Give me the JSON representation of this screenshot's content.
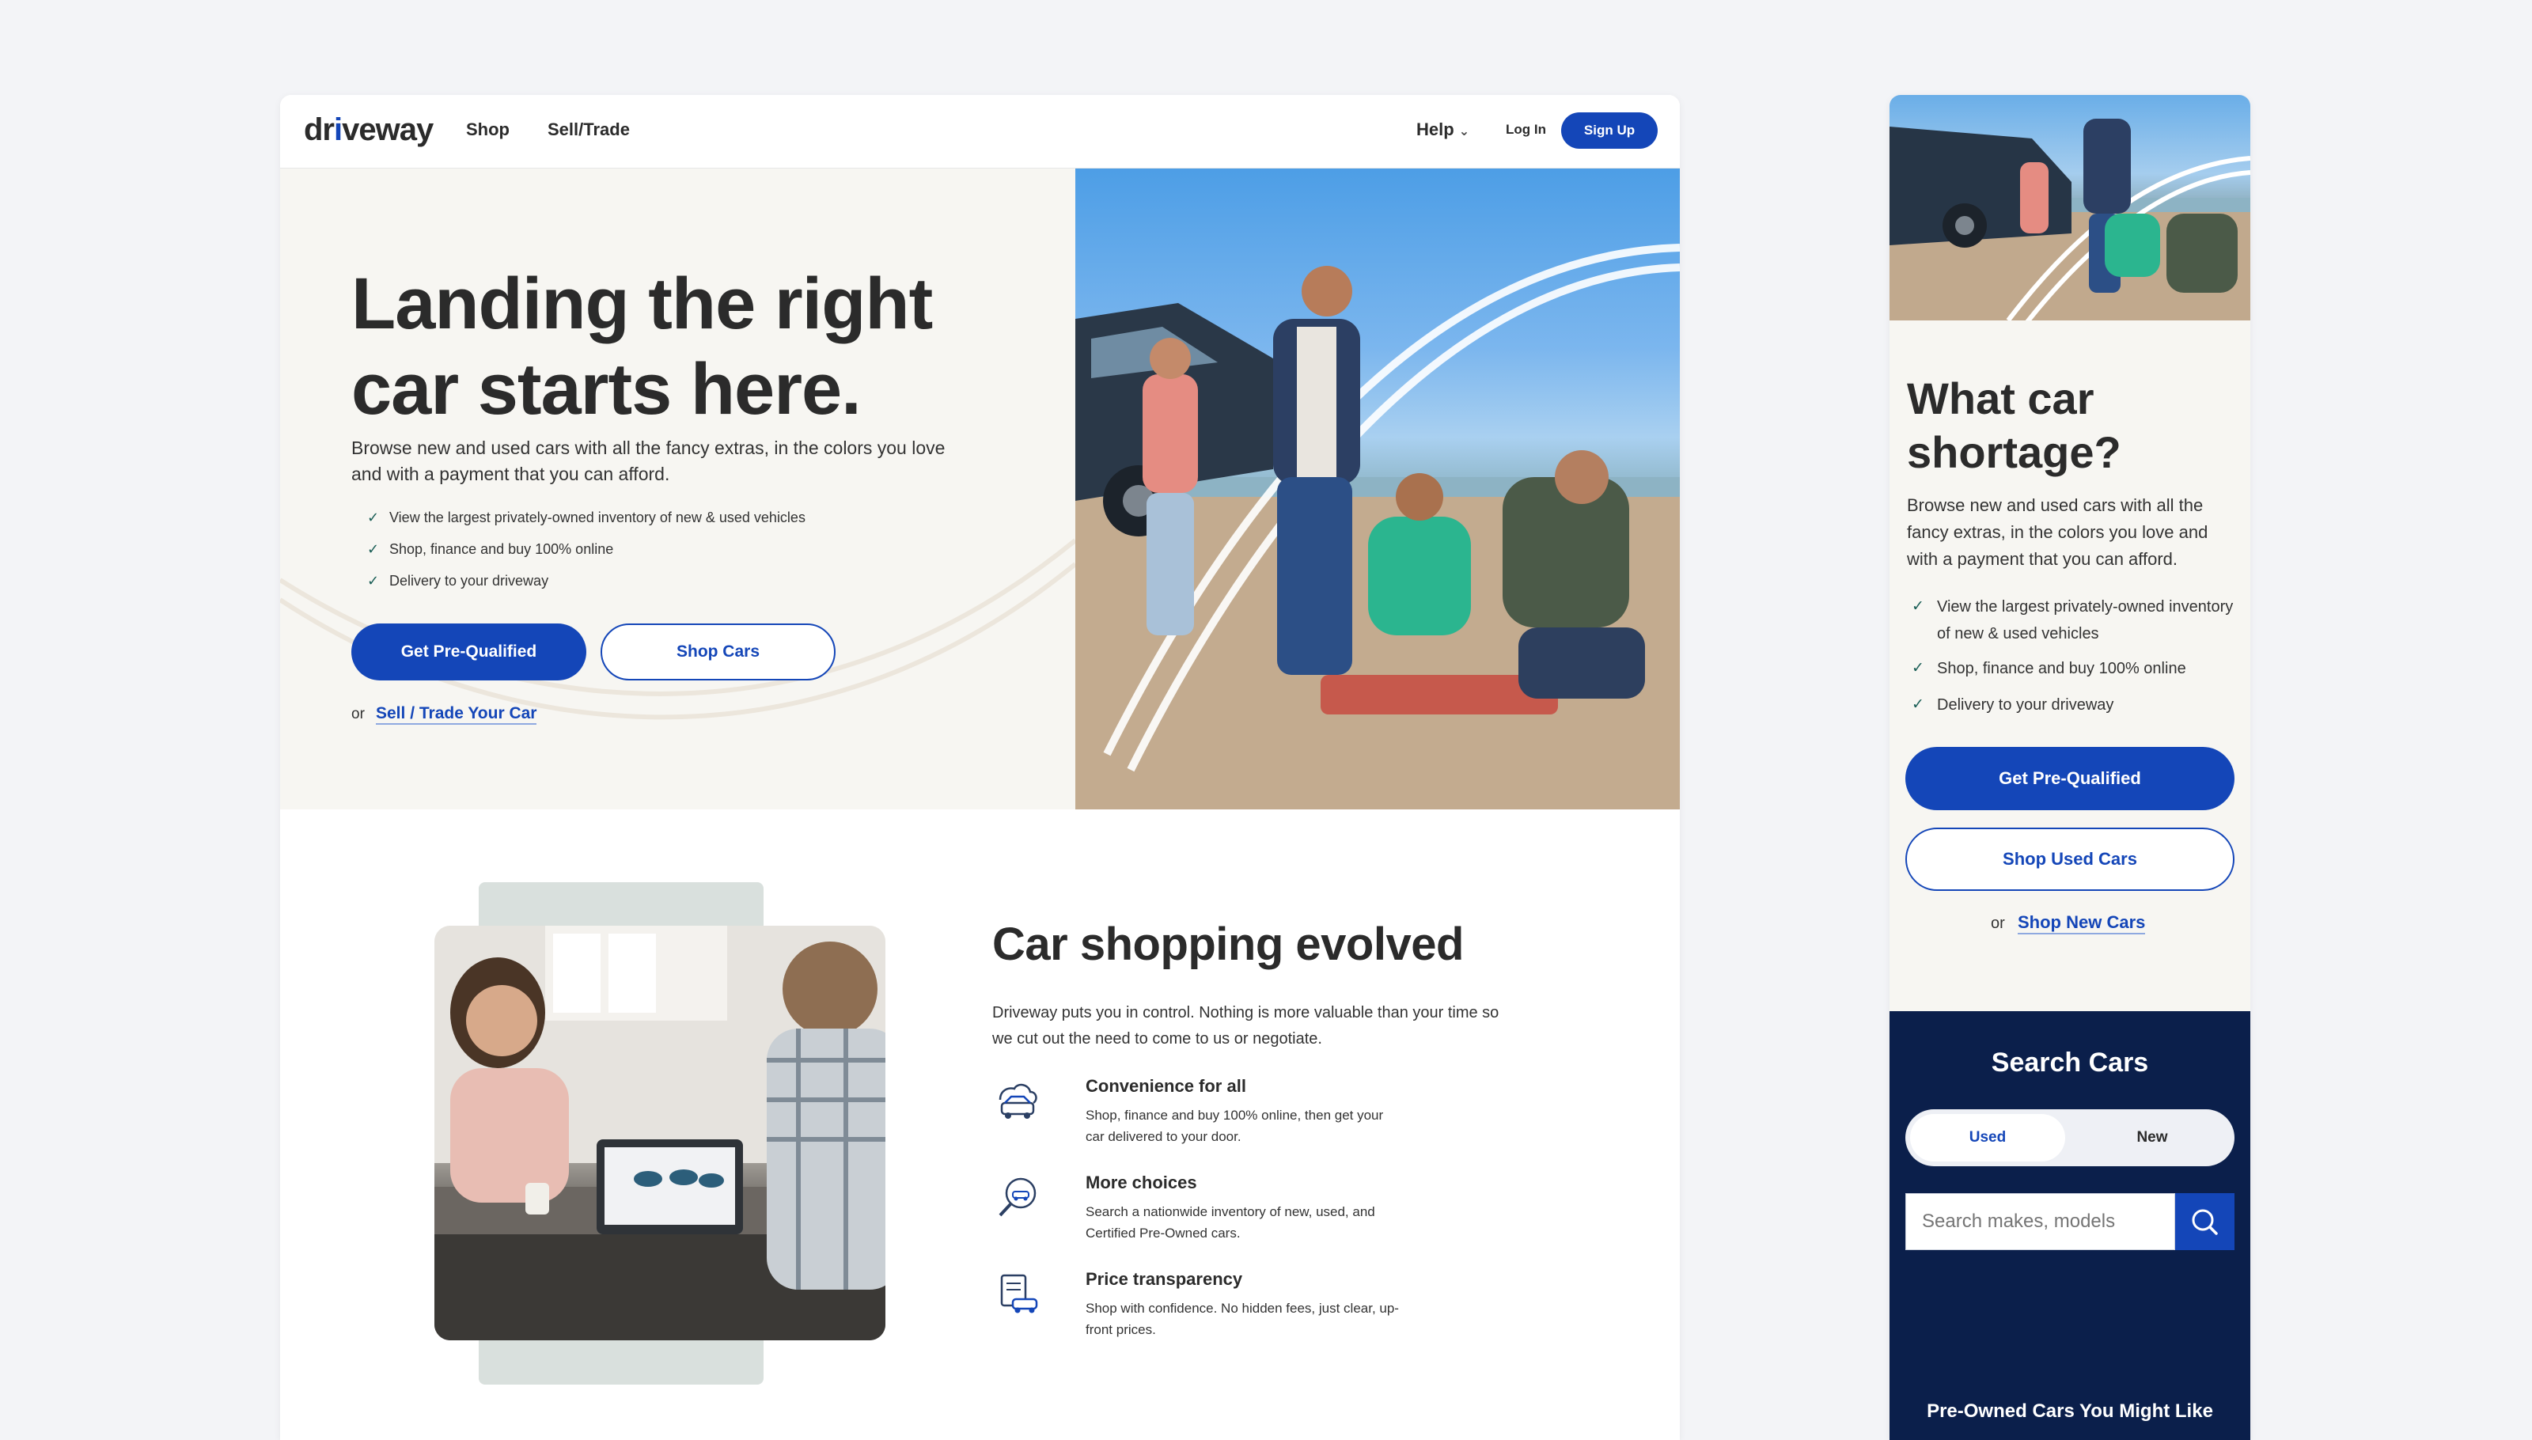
{
  "nav": {
    "logo": "driveway",
    "links": [
      "Shop",
      "Sell/Trade"
    ],
    "help": "Help",
    "login": "Log In",
    "signup": "Sign Up"
  },
  "hero": {
    "title_line1": "Landing the right",
    "title_line2": "car starts here.",
    "subtitle": "Browse new and used cars with all the fancy extras, in the colors you love and with a payment that you can afford.",
    "checks": [
      "View the largest privately-owned inventory of new & used vehicles",
      "Shop, finance and buy 100% online",
      "Delivery to your driveway"
    ],
    "primary_cta": "Get Pre-Qualified",
    "secondary_cta": "Shop Cars",
    "or": "or",
    "link": "Sell / Trade Your Car"
  },
  "evolved": {
    "title": "Car shopping evolved",
    "subtitle": "Driveway puts you in control. Nothing is more valuable than your time so we cut out the need to come to us or negotiate.",
    "features": [
      {
        "title": "Convenience for all",
        "desc": "Shop, finance and buy 100% online, then get your car delivered to your door.",
        "icon": "car-delivery-icon"
      },
      {
        "title": "More choices",
        "desc": "Search a nationwide inventory of new, used, and Certified Pre-Owned cars.",
        "icon": "car-search-icon"
      },
      {
        "title": "Price transparency",
        "desc": "Shop with confidence. No hidden fees, just clear, up-front prices.",
        "icon": "price-tag-car-icon"
      }
    ]
  },
  "mobile": {
    "title_line1": "What car",
    "title_line2": "shortage?",
    "subtitle": "Browse new and used cars with all the fancy extras, in the colors you love and with a payment that you can afford.",
    "checks": [
      "View the largest privately-owned inventory of new & used vehicles",
      "Shop, finance and buy 100% online",
      "Delivery to your driveway"
    ],
    "primary_cta": "Get Pre-Qualified",
    "secondary_cta": "Shop Used Cars",
    "or": "or",
    "link": "Shop New Cars",
    "search": {
      "title": "Search Cars",
      "toggle_on": "Used",
      "toggle_off": "New",
      "placeholder": "Search makes, models",
      "preowned": "Pre-Owned Cars You Might Like"
    }
  },
  "colors": {
    "brand_blue": "#1446b8",
    "navy": "#0b1f4b",
    "cream": "#f7f6f2",
    "check_green": "#1a5e56"
  }
}
